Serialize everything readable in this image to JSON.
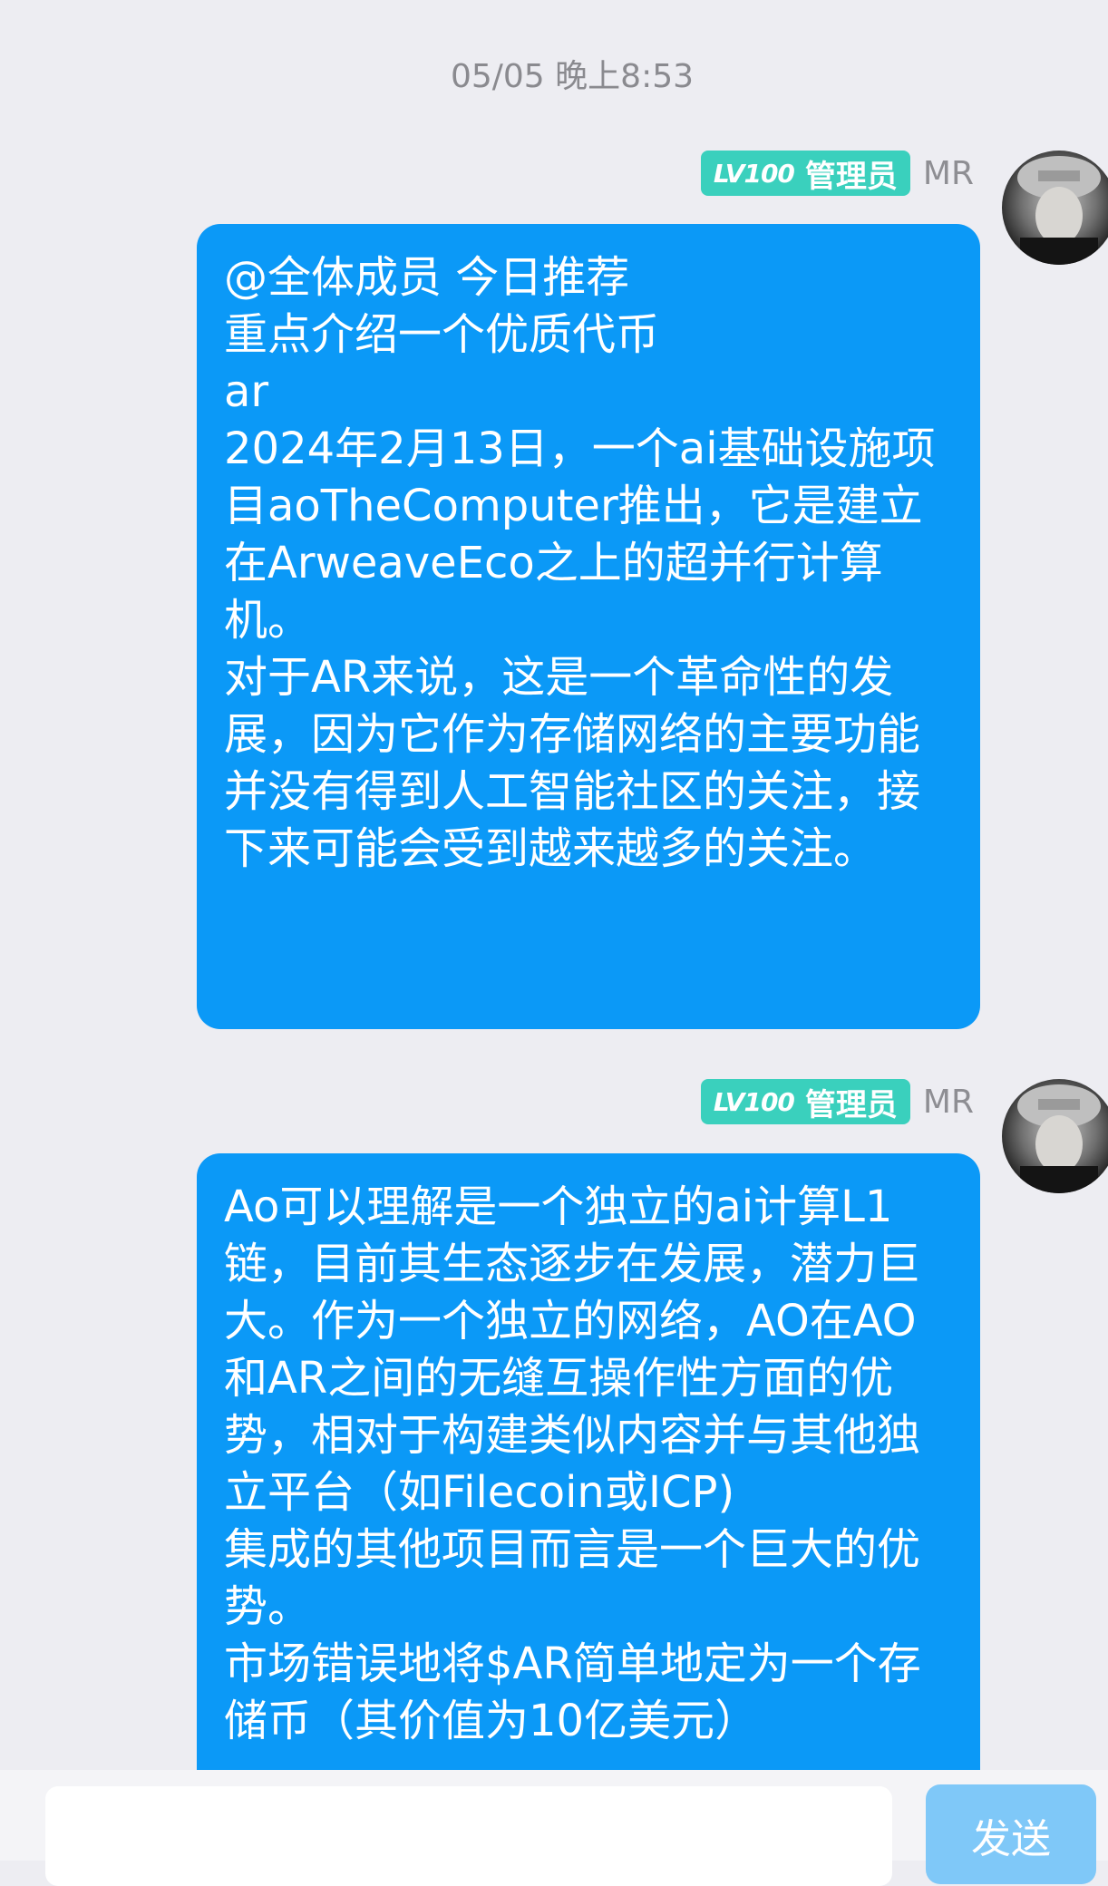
{
  "chat": {
    "timestamp": "05/05 晚上8:53",
    "messages": [
      {
        "sender": {
          "level": "LV100",
          "role": "管理员",
          "name": "MR",
          "avatar": "avatar-photo"
        },
        "text": "@全体成员 今日推荐\n重点介绍一个优质代币\nar\n2024年2月13日，一个ai基础设施项目aoTheComputer推出，它是建立在ArweaveEco之上的超并行计算机。\n对于AR来说，这是一个革命性的发展，因为它作为存储网络的主要功能并没有得到人工智能社区的关注，接下来可能会受到越来越多的关注。"
      },
      {
        "sender": {
          "level": "LV100",
          "role": "管理员",
          "name": "MR",
          "avatar": "avatar-photo"
        },
        "text": "Ao可以理解是一个独立的ai计算L1链，目前其生态逐步在发展，潜力巨大。作为一个独立的网络，AO在AO和AR之间的无缝互操作性方面的优势，相对于构建类似内容并与其他独立平台（如Filecoin或ICP)\n集成的其他项目而言是一个巨大的优势。\n市场错误地将$AR简单地定为一个存储币（其价值为10亿美元）"
      }
    ]
  },
  "input": {
    "value": "",
    "placeholder": ""
  },
  "send_button": {
    "label": "发送"
  },
  "colors": {
    "background": "#ededf2",
    "bubble": "#0b99f7",
    "badge": "#3ad0bd",
    "send_button_disabled": "#7fc8f8"
  }
}
